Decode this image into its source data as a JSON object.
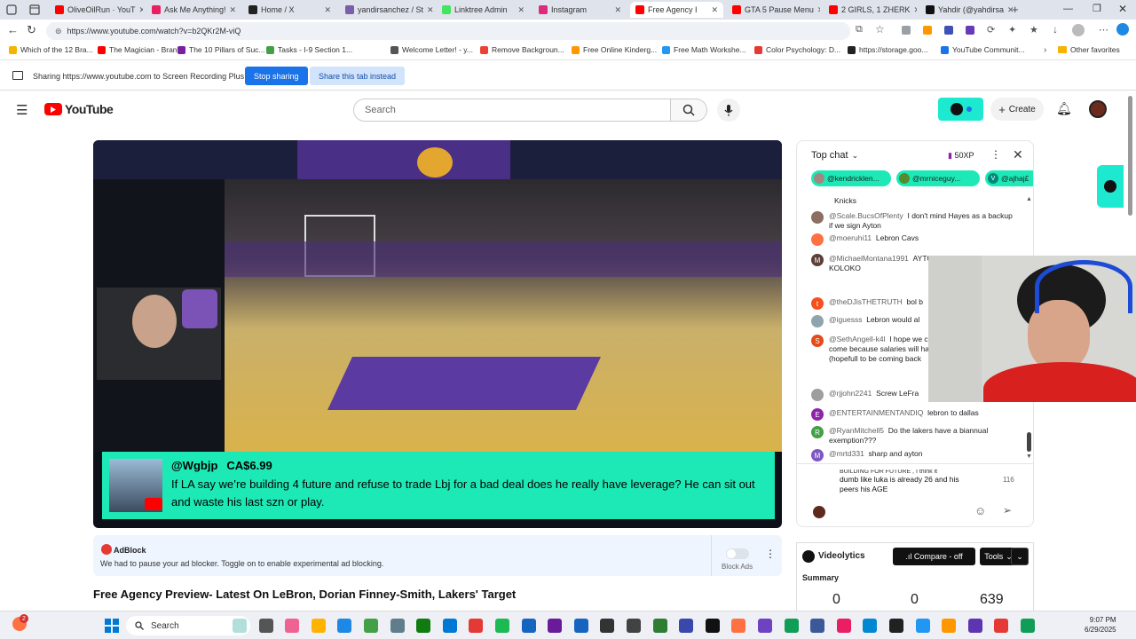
{
  "tabs": [
    {
      "label": "OliveOilRun · YouT",
      "color": "#ff0000"
    },
    {
      "label": "Ask Me Anything!",
      "color": "#e91e63"
    },
    {
      "label": "Home / X",
      "color": "#222"
    },
    {
      "label": "yandirsanchez / St",
      "color": "#7b5ea7"
    },
    {
      "label": "Linktree Admin",
      "color": "#43e55e"
    },
    {
      "label": "Instagram",
      "color": "#dd2a7b"
    },
    {
      "label": "Free Agency I",
      "color": "#ff0000"
    },
    {
      "label": "GTA 5 Pause Menu",
      "color": "#ff0000"
    },
    {
      "label": "2 GIRLS, 1 ZHERK",
      "color": "#ff0000"
    },
    {
      "label": "Yahdir (@yahdirsa",
      "color": "#111"
    }
  ],
  "url": "https://www.youtube.com/watch?v=b2QKr2M-viQ",
  "bookmarks": [
    "Which of the 12 Bra...",
    "The Magician - Bran...",
    "The 10 Pillars of Suc...",
    "Tasks - I-9 Section 1...",
    "Welcome Letter! - y...",
    "Remove Backgroun...",
    "Free Online Kinderg...",
    "Free Math Workshe...",
    "Color Psychology: D...",
    "https://storage.goo...",
    "YouTube Communit..."
  ],
  "other_favorites": "Other favorites",
  "sharing": {
    "text": "Sharing https://www.youtube.com to Screen Recording Plus",
    "stop": "Stop sharing",
    "share_tab": "Share this tab instead"
  },
  "yt": {
    "logo": "YouTube",
    "search_placeholder": "Search",
    "create": "Create"
  },
  "video": {
    "superchat": {
      "user": "@Wgbjp",
      "amount": "CA$6.99",
      "message": "If LA say we’re building 4 future and refuse to trade Lbj for a bad deal does he really have leverage? He can sit out and waste his last szn or play."
    }
  },
  "adblock": {
    "title": "AdBlock",
    "message": "We had to pause your ad blocker. Toggle on to enable experimental ad blocking.",
    "toggle_label": "Block Ads"
  },
  "video_title": "Free Agency Preview- Latest On LeBron, Dorian Finney-Smith, Lakers' Target",
  "chat": {
    "header": "Top chat",
    "xp": "50XP",
    "pinned": [
      "@kendricklen...",
      "@mrniceguy...",
      "@ajhaj£"
    ],
    "first_line": "Knicks",
    "messages": [
      {
        "author": "@Scale.BucsOfPlenty",
        "text": "I don't mind Hayes as a backup if we sign Ayton",
        "avatar_color": "#8d6e63",
        "initial": ""
      },
      {
        "author": "@moeruhi11",
        "text": "Lebron Cavs",
        "avatar_color": "#ff7043",
        "initial": ""
      },
      {
        "author": "@MichaelMontana1991",
        "text": "AYTON CAPELLA JEMISON KOLOKO",
        "avatar_color": "#5d4037",
        "initial": "M"
      },
      {
        "author": "@theDJisTHETRUTH",
        "text": "bol b",
        "avatar_color": "#f4511e",
        "initial": "t"
      },
      {
        "author": "@iguesss",
        "text": "Lebron would al",
        "avatar_color": "#90a4ae",
        "initial": ""
      },
      {
        "author": "@SethAngell-k4l",
        "text": "I hope we can't fully dictate who come because salaries will have t Someone notable (hopefull to be coming back",
        "avatar_color": "#e64a19",
        "initial": "S"
      },
      {
        "author": "@rjjohn2241",
        "text": "Screw LeFra",
        "avatar_color": "#9e9e9e",
        "initial": ""
      },
      {
        "author": "@ENTERTAINMENTANDIQ",
        "text": "lebron to dallas",
        "avatar_color": "#8e24aa",
        "initial": "E"
      },
      {
        "author": "@RyanMitchell5",
        "text": "Do the lakers have a biannual exemption???",
        "avatar_color": "#43a047",
        "initial": "R"
      },
      {
        "author": "@mrtd331",
        "text": "sharp and ayton",
        "avatar_color": "#7e57c2",
        "initial": "M"
      }
    ],
    "input_text": "dumb like luka is already 26 and his peers his AGE",
    "input_overflow": "BUILDING FOR FUTURE , I think it",
    "char_count": "116"
  },
  "videolytics": {
    "title": "Videolytics",
    "compare": ".ıl Compare - off",
    "tools": "Tools",
    "summary": "Summary",
    "stats": [
      "0",
      "0",
      "639"
    ]
  },
  "taskbar": {
    "search": "Search",
    "time": "9:07 PM",
    "date": "6/29/2025",
    "badge": "2"
  }
}
